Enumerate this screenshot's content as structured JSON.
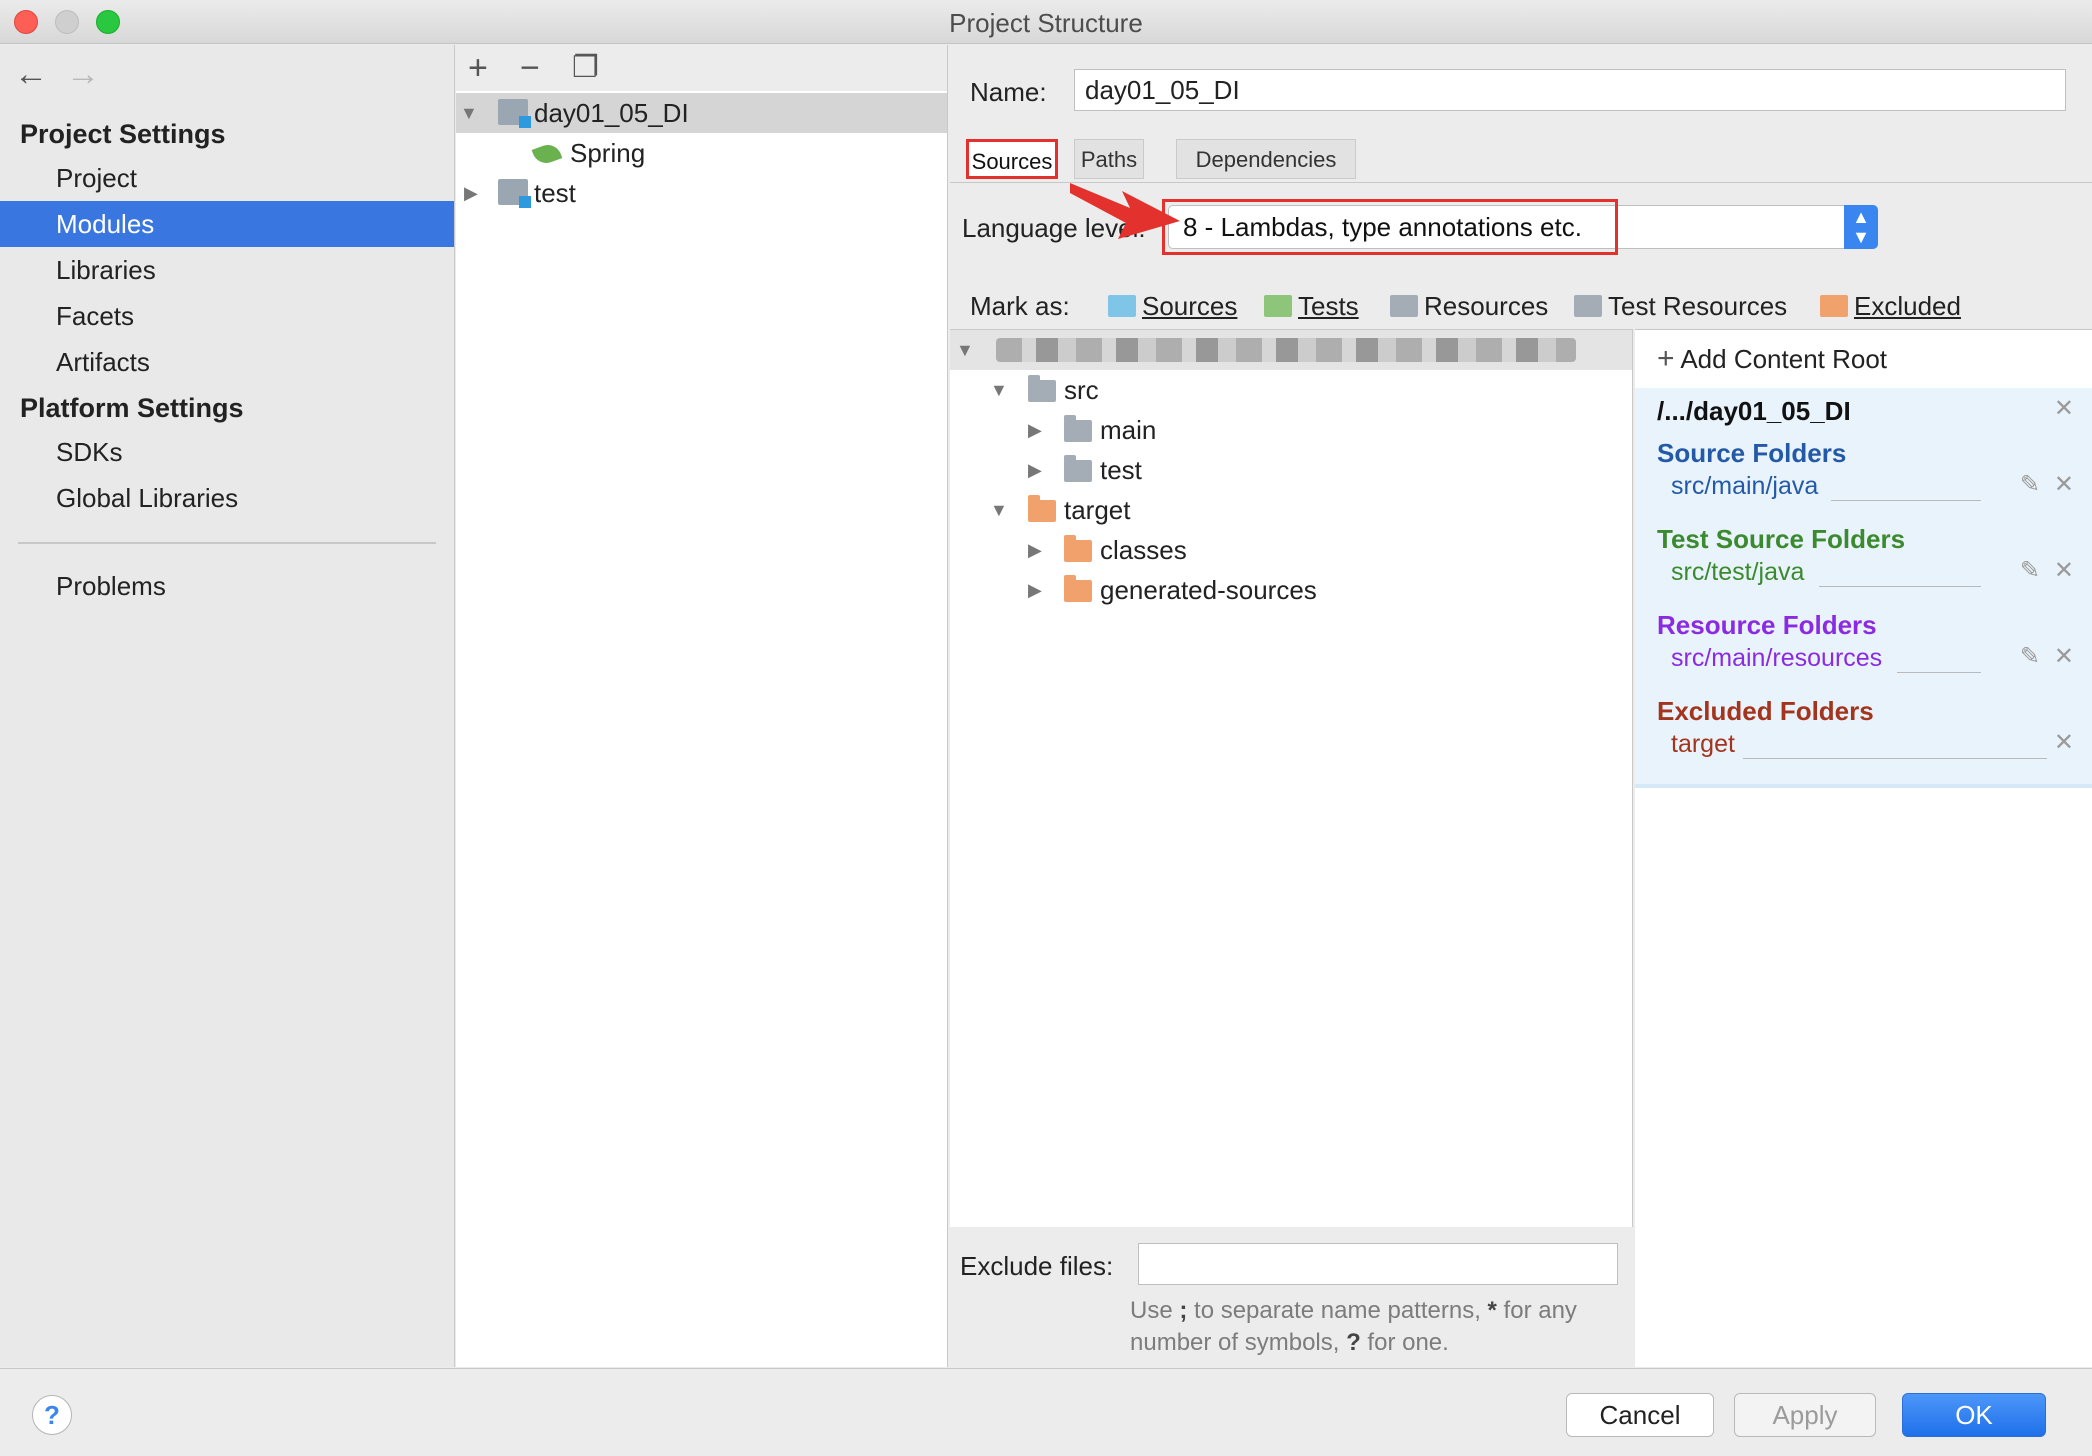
{
  "window": {
    "title": "Project Structure"
  },
  "nav": {
    "back_icon": "arrow-left-icon",
    "forward_icon": "arrow-right-icon",
    "project_settings_heading": "Project Settings",
    "project_items": [
      "Project",
      "Modules",
      "Libraries",
      "Facets",
      "Artifacts"
    ],
    "selected": "Modules",
    "platform_settings_heading": "Platform Settings",
    "platform_items": [
      "SDKs",
      "Global Libraries"
    ],
    "problems": "Problems"
  },
  "modules": {
    "toolbar_icons": [
      "plus-icon",
      "minus-icon",
      "copy-icon"
    ],
    "tree": {
      "root": "day01_05_DI",
      "child": "Spring",
      "second": "test"
    }
  },
  "config": {
    "name_label": "Name:",
    "name_value": "day01_05_DI",
    "tabs": [
      "Sources",
      "Paths",
      "Dependencies"
    ],
    "active_tab": "Sources",
    "language_level_label": "Language level:",
    "language_level_value": "8 - Lambdas, type annotations etc.",
    "mark_as_label": "Mark as:",
    "mark_as": [
      {
        "label": "Sources",
        "color": "#7fc5e8"
      },
      {
        "label": "Tests",
        "color": "#8dc57a"
      },
      {
        "label": "Resources",
        "color": "#a4adb6"
      },
      {
        "label": "Test Resources",
        "color": "#a4adb6"
      },
      {
        "label": "Excluded",
        "color": "#f1a26c"
      }
    ],
    "content_tree": {
      "src": "src",
      "main": "main",
      "test": "test",
      "target": "target",
      "classes": "classes",
      "generated": "generated-sources"
    },
    "exclude_label": "Exclude files:",
    "exclude_value": "",
    "exclude_hint_1": "Use ",
    "exclude_hint_semi": ";",
    "exclude_hint_2": " to separate name patterns, ",
    "exclude_hint_star": "*",
    "exclude_hint_3": " for any number of symbols, ",
    "exclude_hint_q": "?",
    "exclude_hint_4": " for one."
  },
  "roots": {
    "add_content_root": "Add Content Root",
    "path": "/.../day01_05_DI",
    "source_heading": "Source Folders",
    "source_value": "src/main/java",
    "test_heading": "Test Source Folders",
    "test_value": "src/test/java",
    "resource_heading": "Resource Folders",
    "resource_value": "src/main/resources",
    "excluded_heading": "Excluded Folders",
    "excluded_value": "target",
    "colors": {
      "source": "#2459a8",
      "test": "#3b8a2f",
      "resource": "#8a2be2",
      "excluded": "#a3341d"
    }
  },
  "footer": {
    "help": "?",
    "cancel": "Cancel",
    "apply": "Apply",
    "ok": "OK"
  }
}
